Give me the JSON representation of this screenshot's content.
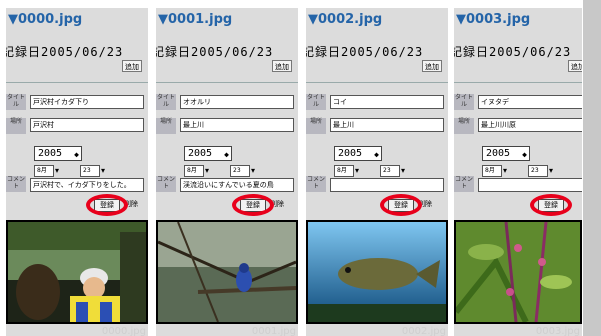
{
  "cards": [
    {
      "filename": "▼0000.jpg",
      "registered": "記録日2005/06/23",
      "small_btn": "追加",
      "row1_label": "タイトル",
      "row1_value": "戸沢村イカダ下り",
      "row2_label": "場所",
      "row2_value": "戸沢村",
      "year": "2005",
      "mini1": "8月",
      "mini2": "23",
      "row4_label": "コメント",
      "row4_value": "戸沢村で、イカダ下りをした。",
      "upload": "登録",
      "delete": "削除",
      "caption": "0000.jpg"
    },
    {
      "filename": "▼0001.jpg",
      "registered": "記録日2005/06/23",
      "small_btn": "追加",
      "row1_label": "タイトル",
      "row1_value": "オオルリ",
      "row2_label": "場所",
      "row2_value": "最上川",
      "year": "2005",
      "mini1": "8月",
      "mini2": "23",
      "row4_label": "コメント",
      "row4_value": "渓流沿いにすんでいる夏の鳥",
      "upload": "登録",
      "delete": "削除",
      "caption": "0001.jpg"
    },
    {
      "filename": "▼0002.jpg",
      "registered": "記録日2005/06/23",
      "small_btn": "追加",
      "row1_label": "タイトル",
      "row1_value": "コイ",
      "row2_label": "場所",
      "row2_value": "最上川",
      "year": "2005",
      "mini1": "8月",
      "mini2": "23",
      "row4_label": "コメント",
      "row4_value": "",
      "upload": "登録",
      "delete": "削除",
      "caption": "0002.jpg"
    },
    {
      "filename": "▼0003.jpg",
      "registered": "記録日2005/06/23",
      "small_btn": "追加",
      "row1_label": "タイトル",
      "row1_value": "イヌタデ",
      "row2_label": "場所",
      "row2_value": "最上川川原",
      "year": "2005",
      "mini1": "8月",
      "mini2": "23",
      "row4_label": "コメント",
      "row4_value": "",
      "upload": "登録",
      "delete": "削除",
      "caption": "0003.jpg"
    }
  ]
}
